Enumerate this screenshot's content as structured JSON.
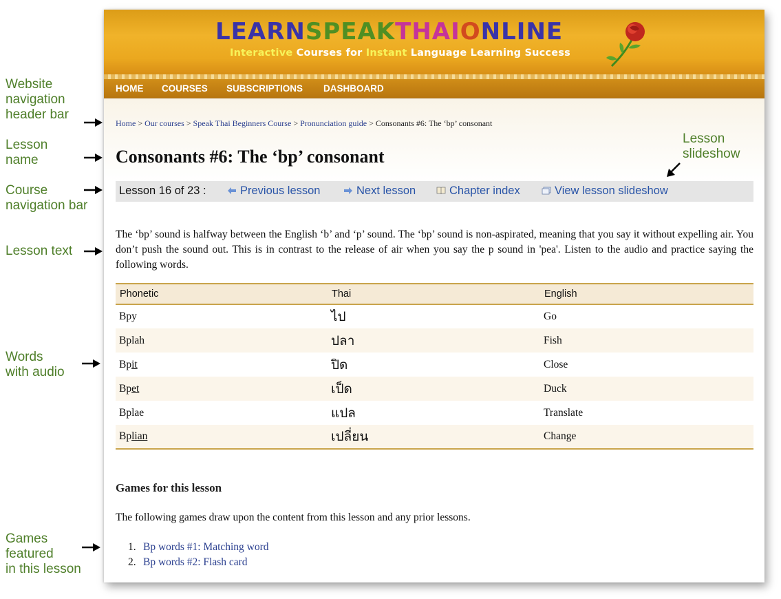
{
  "annotations": {
    "header_bar": "Website\nnavigation\nheader bar",
    "lesson_name": "Lesson\nname",
    "course_nav": "Course\nnavigation bar",
    "lesson_text": "Lesson text",
    "words_audio": "Words\nwith audio",
    "games": "Games\nfeatured\nin this lesson",
    "slideshow": "Lesson\nslideshow"
  },
  "logo": {
    "part1": "LEARN",
    "part2": "SPEAK",
    "part3": "THAI",
    "part4": "O",
    "part5": "NLINE",
    "tagline": {
      "w1": "Interactive",
      "w2": " Courses for ",
      "w3": "Instant",
      "w4": " Language Learning Success"
    }
  },
  "nav": {
    "home": "HOME",
    "courses": "COURSES",
    "subscriptions": "SUBSCRIPTIONS",
    "dashboard": "DASHBOARD"
  },
  "breadcrumb": {
    "items": [
      "Home",
      "Our courses",
      "Speak Thai Beginners Course",
      "Pronunciation guide"
    ],
    "separator": " > ",
    "current": "Consonants #6: The ‘bp’ consonant"
  },
  "lesson": {
    "title": "Consonants #6: The ‘bp’ consonant",
    "count": "Lesson 16 of 23 :",
    "previous": "Previous lesson",
    "next": "Next lesson",
    "chapter_index": "Chapter index",
    "slideshow": "View lesson slideshow",
    "text": "The ‘bp’ sound is halfway between the English ‘b’ and ‘p’ sound. The ‘bp’ sound is non-aspirated, meaning that you say it without expelling air. You don’t push the sound out. This is in contrast to the release of air when you say the p sound in 'pea'. Listen to the audio and practice saying the following words."
  },
  "table": {
    "headers": [
      "Phonetic",
      "Thai",
      "English"
    ],
    "rows": [
      {
        "ph_a": "Bpy",
        "ph_b": "",
        "thai": "ไป",
        "english": "Go"
      },
      {
        "ph_a": "Bplah",
        "ph_b": "",
        "thai": "ปลา",
        "english": "Fish"
      },
      {
        "ph_a": "Bp",
        "ph_b": "it",
        "thai": "ปิด",
        "english": "Close"
      },
      {
        "ph_a": "Bp",
        "ph_b": "et",
        "thai": "เป็ด",
        "english": "Duck"
      },
      {
        "ph_a": "Bplae",
        "ph_b": "",
        "thai": "แปล",
        "english": "Translate"
      },
      {
        "ph_a": "Bp",
        "ph_b": "lian",
        "thai": "เปลี่ยน",
        "english": "Change"
      }
    ]
  },
  "games": {
    "heading": "Games for this lesson",
    "intro": "The following games draw upon the content from this lesson and any prior lessons.",
    "items": [
      {
        "num": "1.",
        "label": "Bp words #1: Matching word"
      },
      {
        "num": "2.",
        "label": "Bp words #2: Flash card"
      }
    ]
  },
  "colors": {
    "annotation": "#4f7f2a",
    "link": "#2a3f8f",
    "banner": "#eba81f",
    "table_rule": "#c9a44b"
  }
}
